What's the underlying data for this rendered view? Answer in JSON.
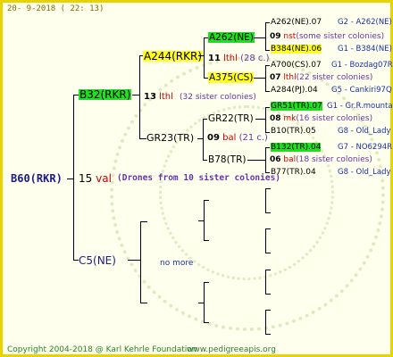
{
  "header": {
    "date": "20-  9-2018 ( 22: 13)"
  },
  "footer": {
    "copyright": "Copyright 2004-2018 @ Karl Kehrle Foundation",
    "site": "www.pedigreeapis.org"
  },
  "colors": {
    "border": "#e8d200",
    "highlight_green": "#22dd22",
    "highlight_yellow": "#ffff22",
    "red": "#cc0000",
    "blue": "#1a2fa8"
  },
  "root": {
    "label": "B60(RKR)",
    "gen": "15",
    "suffix": "val",
    "note": "(Drones from 10 sister colonies)"
  },
  "gen1": {
    "top": {
      "label": "B32(RKR)",
      "gen": "13",
      "suffix": "lthl",
      "note": "(32 sister colonies)"
    },
    "bottom": {
      "label": "C5(NE)",
      "note": "no more"
    }
  },
  "gen2": {
    "top": {
      "label": "A244(RKR)",
      "gen": "11",
      "suffix": "lthl",
      "note": "(28 c.)"
    },
    "bottom": {
      "label": "GR23(TR)",
      "gen": "09",
      "suffix": "bal",
      "note": "(21 c.)"
    }
  },
  "gen3": [
    {
      "label": "A262(NE)",
      "gen": "09",
      "suffix": "nst",
      "note": "(some sister colonies)"
    },
    {
      "label": "A375(CS)",
      "gen": "07",
      "suffix": "lthl",
      "note": "(22 sister colonies)"
    },
    {
      "label": "GR22(TR)",
      "gen": "08",
      "suffix": "mk",
      "note": "(16 sister colonies)"
    },
    {
      "label": "B78(TR)",
      "gen": "06",
      "suffix": "bal",
      "note": "(18 sister colonies)"
    }
  ],
  "gen4": [
    {
      "name": "A262(NE).07",
      "info": "G2 - A262(NE)"
    },
    {
      "name": "B384(NE).06",
      "info": "G1 - B384(NE)"
    },
    {
      "name": "A700(CS).07",
      "info": "G1 - Bozdag07R"
    },
    {
      "name": "A284(PJ).04",
      "info": "G5 - Cankiri97Q"
    },
    {
      "name": "GR51(TR).07",
      "info": "G1 - Gr.R.mounta"
    },
    {
      "name": "B10(TR).05",
      "info": "G8 - Old_Lady"
    },
    {
      "name": "B132(TR).04",
      "info": "G7 - NO6294R"
    },
    {
      "name": "B77(TR).04",
      "info": "G8 - Old_Lady"
    }
  ]
}
